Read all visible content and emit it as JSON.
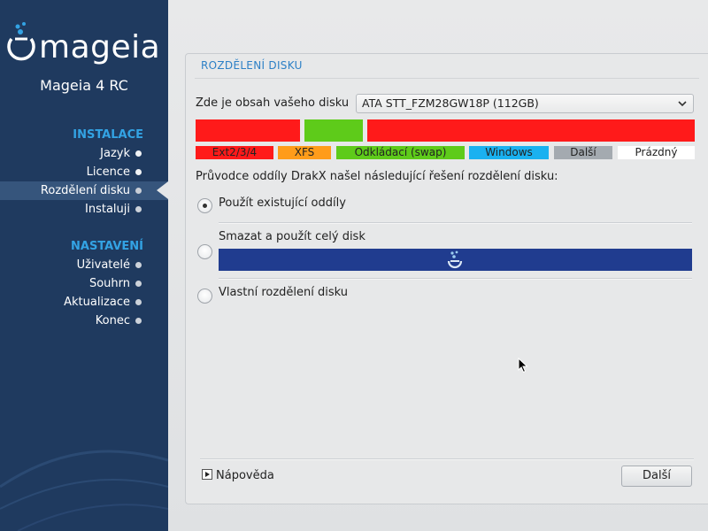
{
  "sidebar": {
    "logo_text": "mageia",
    "version": "Mageia 4 RC",
    "sections": [
      {
        "title": "INSTALACE",
        "items": [
          {
            "label": "Jazyk",
            "state": "done"
          },
          {
            "label": "Licence",
            "state": "done"
          },
          {
            "label": "Rozdělení disku",
            "state": "active"
          },
          {
            "label": "Instaluji",
            "state": "pending"
          }
        ]
      },
      {
        "title": "NASTAVENÍ",
        "items": [
          {
            "label": "Uživatelé",
            "state": "pending"
          },
          {
            "label": "Souhrn",
            "state": "pending"
          },
          {
            "label": "Aktualizace",
            "state": "pending"
          },
          {
            "label": "Konec",
            "state": "pending"
          }
        ]
      }
    ]
  },
  "panel": {
    "title": "ROZDĚLENÍ DISKU",
    "disk_label": "Zde je obsah vašeho disku",
    "disk_select_value": "ATA STT_FZM28GW18P (112GB)",
    "legend": [
      {
        "label": "Ext2/3/4",
        "color": "#ff1a1a"
      },
      {
        "label": "XFS",
        "color": "#ff9c1a"
      },
      {
        "label": "Odkládací (swap)",
        "color": "#5ecb1a"
      },
      {
        "label": "Windows",
        "color": "#1ab1f0"
      },
      {
        "label": "Další",
        "color": "#a4aab0"
      },
      {
        "label": "Prázdný",
        "color": "#ffffff"
      }
    ],
    "partition_colors": {
      "ext": "#ff1a1a",
      "swap": "#5ecb1a"
    },
    "wizard_text": "Průvodce oddíly DrakX našel následující řešení rozdělení disku:",
    "options": [
      {
        "label": "Použít existující oddíly",
        "checked": true
      },
      {
        "label": "Smazat a použít celý disk",
        "checked": false
      },
      {
        "label": "Vlastní rozdělení disku",
        "checked": false
      }
    ],
    "erase_bar_color": "#203c8f",
    "help_label": "Nápověda",
    "next_label": "Další"
  }
}
